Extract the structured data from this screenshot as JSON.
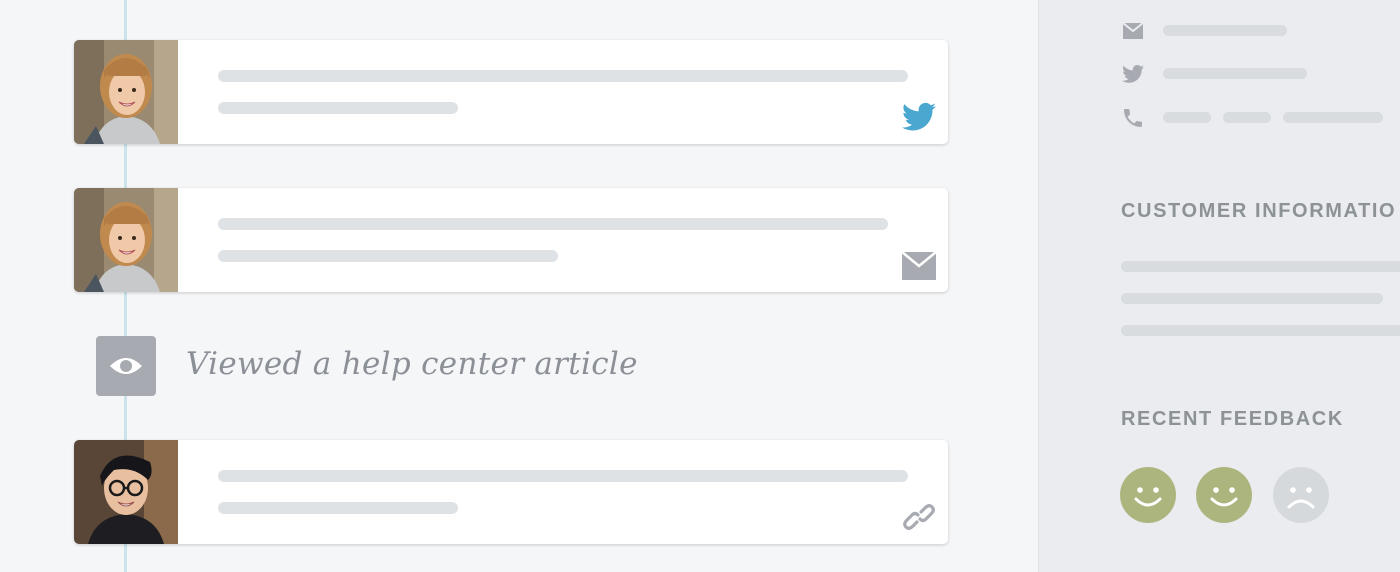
{
  "timeline": {
    "cards": [
      {
        "kind": "customer",
        "channel": "twitter-icon"
      },
      {
        "kind": "customer",
        "channel": "mail-icon"
      },
      {
        "kind": "agent",
        "channel": "link-icon"
      }
    ],
    "event": {
      "icon": "eye-icon",
      "text": "Viewed a help center article"
    }
  },
  "sidebar": {
    "contact_icons": [
      "mail-icon",
      "twitter-icon",
      "phone-icon"
    ],
    "customer_info_title": "CUSTOMER INFORMATIO",
    "recent_feedback_title": "RECENT FEEDBACK",
    "feedback": [
      "positive",
      "positive",
      "negative"
    ]
  },
  "colors": {
    "background": "#f5f6f8",
    "card": "#ffffff",
    "placeholder_bar": "#dfe2e5",
    "twitter_blue": "#4aa8d0",
    "muted_icon": "#a7abb1",
    "sidebar_bg": "#eaecef",
    "positive_face": "#adb57f",
    "negative_face": "#d6d9dc",
    "timeline_line": "#cbe3ea"
  }
}
